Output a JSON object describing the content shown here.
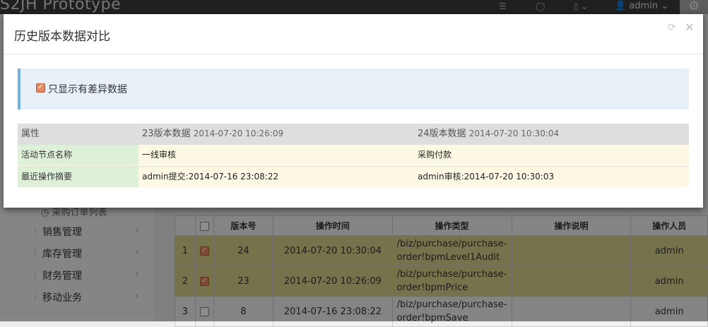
{
  "app": {
    "brand": "S2JH Prototype",
    "user": "admin"
  },
  "sidebar": {
    "sub_item": "采购订单列表",
    "items": [
      {
        "label": "销售管理"
      },
      {
        "label": "库存管理"
      },
      {
        "label": "财务管理"
      },
      {
        "label": "移动业务"
      }
    ]
  },
  "grid": {
    "headers": [
      "",
      "",
      "版本号",
      "操作时间",
      "操作类型",
      "操作说明",
      "操作人员"
    ],
    "rows": [
      {
        "index": "1",
        "checked": true,
        "version": "24",
        "time": "2014-07-20 10:30:04",
        "type_line1": "/biz/purchase/purchase-",
        "type_line2": "order!bpmLevel1Audit",
        "desc": "",
        "user": "admin"
      },
      {
        "index": "2",
        "checked": true,
        "version": "23",
        "time": "2014-07-20 10:26:09",
        "type_line1": "/biz/purchase/purchase-",
        "type_line2": "order!bpmPrice",
        "desc": "",
        "user": "admin"
      },
      {
        "index": "3",
        "checked": false,
        "version": "8",
        "time": "2014-07-16 23:08:22",
        "type_line1": "/biz/purchase/purchase-",
        "type_line2": "order!bpmSave",
        "desc": "",
        "user": "admin"
      }
    ]
  },
  "modal": {
    "title": "历史版本数据对比",
    "diff_only_label": "只显示有差异数据",
    "diff_only_checked": true,
    "compare": {
      "header": {
        "attr": "属性",
        "left_version": "23版本数据",
        "left_time": "2014-07-20 10:26:09",
        "right_version": "24版本数据",
        "right_time": "2014-07-20 10:30:04"
      },
      "rows": [
        {
          "attr": "活动节点名称",
          "left": "一线审核",
          "right": "采购付款"
        },
        {
          "attr": "最近操作摘要",
          "left": "admin提交:2014-07-16 23:08:22",
          "right": "admin审核:2014-07-20 10:30:03"
        }
      ]
    }
  },
  "colors": {
    "highlight_row": "#d7d08b",
    "attr_cell": "#dff0d8",
    "value_cell": "#fcf8e3",
    "alert_bg": "#e8f1f8",
    "alert_border": "#6fb3e0"
  }
}
